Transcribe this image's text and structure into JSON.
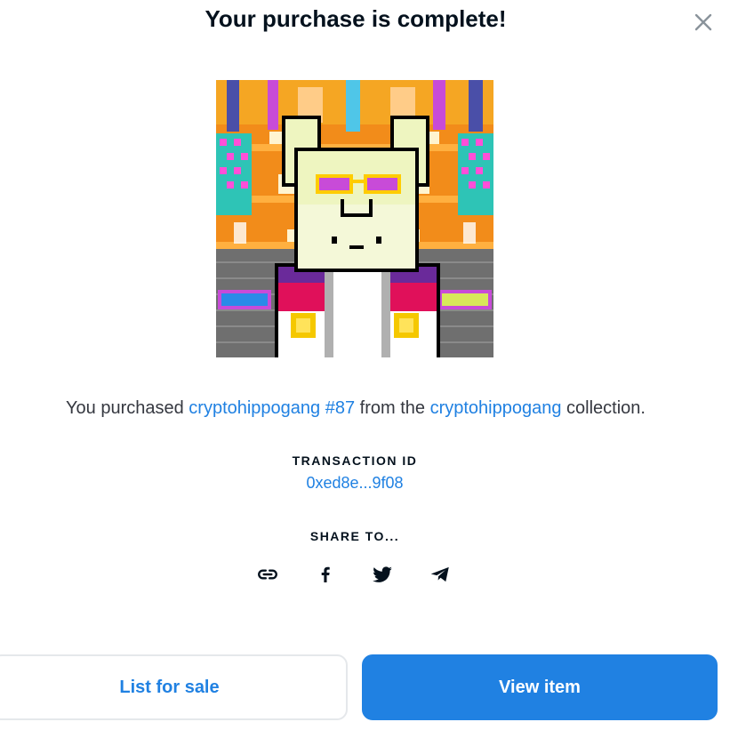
{
  "modal": {
    "title": "Your purchase is complete!",
    "close_icon": "close-icon"
  },
  "purchase": {
    "prefix": "You purchased ",
    "item_name": "cryptohippogang #87",
    "middle": " from the ",
    "collection_name": "cryptohippogang",
    "suffix": " collection."
  },
  "transaction": {
    "label": "TRANSACTION ID",
    "id": "0xed8e...9f08"
  },
  "share": {
    "label": "SHARE TO...",
    "icons": [
      "link-icon",
      "facebook-icon",
      "twitter-icon",
      "telegram-icon"
    ]
  },
  "actions": {
    "list_for_sale": "List for sale",
    "view_item": "View item"
  },
  "colors": {
    "accent": "#2081e2",
    "title": "#04111d",
    "text": "#353840",
    "border": "#e5e8eb"
  }
}
